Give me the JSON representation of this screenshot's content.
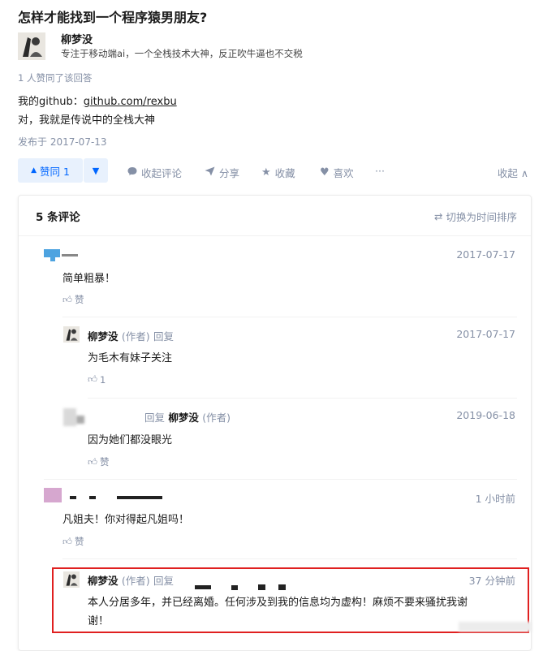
{
  "question": {
    "title": "怎样才能找到一个程序猿男朋友?"
  },
  "answer": {
    "author_name": "柳梦没",
    "author_bio": "专注于移动端ai，一个全栈技术大神，反正吹牛逼也不交税",
    "votes_line": "1 人赞同了该回答",
    "github_prefix": "我的github：",
    "github_link": "github.com/rexbu",
    "line2": "对，我就是传说中的全栈大神",
    "published": "发布于 2017-07-13"
  },
  "actions": {
    "vote_up": "赞同 1",
    "comment": "收起评论",
    "share": "分享",
    "favorite": "收藏",
    "like": "喜欢",
    "more": "···",
    "collapse": "收起"
  },
  "comments_panel": {
    "count": "5 条评论",
    "sort": "切换为时间排序"
  },
  "comments": [
    {
      "text": "简单粗暴！",
      "date": "2017-07-17",
      "like": "赞"
    },
    {
      "author": "柳梦没",
      "role": "(作者)",
      "reply": "回复",
      "text": "为毛木有妹子关注",
      "date": "2017-07-17",
      "like": "1"
    },
    {
      "reply": "回复",
      "author": "柳梦没",
      "role": "(作者)",
      "text": "因为她们都没眼光",
      "date": "2019-06-18",
      "like": "赞"
    },
    {
      "text": "凡姐夫！你对得起凡姐吗！",
      "date": "1 小时前",
      "like": "赞"
    },
    {
      "author": "柳梦没",
      "role": "(作者)",
      "reply": "回复",
      "text_line1": "本人分居多年，并已经离婚。任何涉及到我的信息均为虚构！麻烦不要来骚扰我谢",
      "text_line2": "谢！",
      "date": "37 分钟前"
    }
  ],
  "colors": {
    "accent": "#0066ff",
    "muted": "#8590a6",
    "highlight_border": "#e02020"
  }
}
